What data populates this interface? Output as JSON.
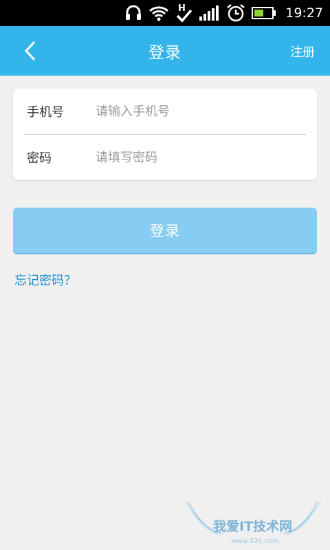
{
  "status_bar": {
    "time": "19:27",
    "network_type": "H",
    "icons": [
      "headset-icon",
      "wifi-icon",
      "data-transfer-icon",
      "signal-icon",
      "alarm-icon",
      "battery-icon"
    ]
  },
  "app_bar": {
    "title": "登录",
    "register_label": "注册",
    "color": "#33b5ec"
  },
  "form": {
    "phone": {
      "label": "手机号",
      "placeholder": "请输入手机号",
      "value": ""
    },
    "password": {
      "label": "密码",
      "placeholder": "请填写密码",
      "value": ""
    }
  },
  "login_button": {
    "label": "登录",
    "color": "#87ccf2"
  },
  "forgot_password": {
    "label": "忘记密码？",
    "color": "#1a8fd0"
  },
  "watermark": {
    "title": "我爱IT技术网",
    "url": "www.52ij.com"
  }
}
